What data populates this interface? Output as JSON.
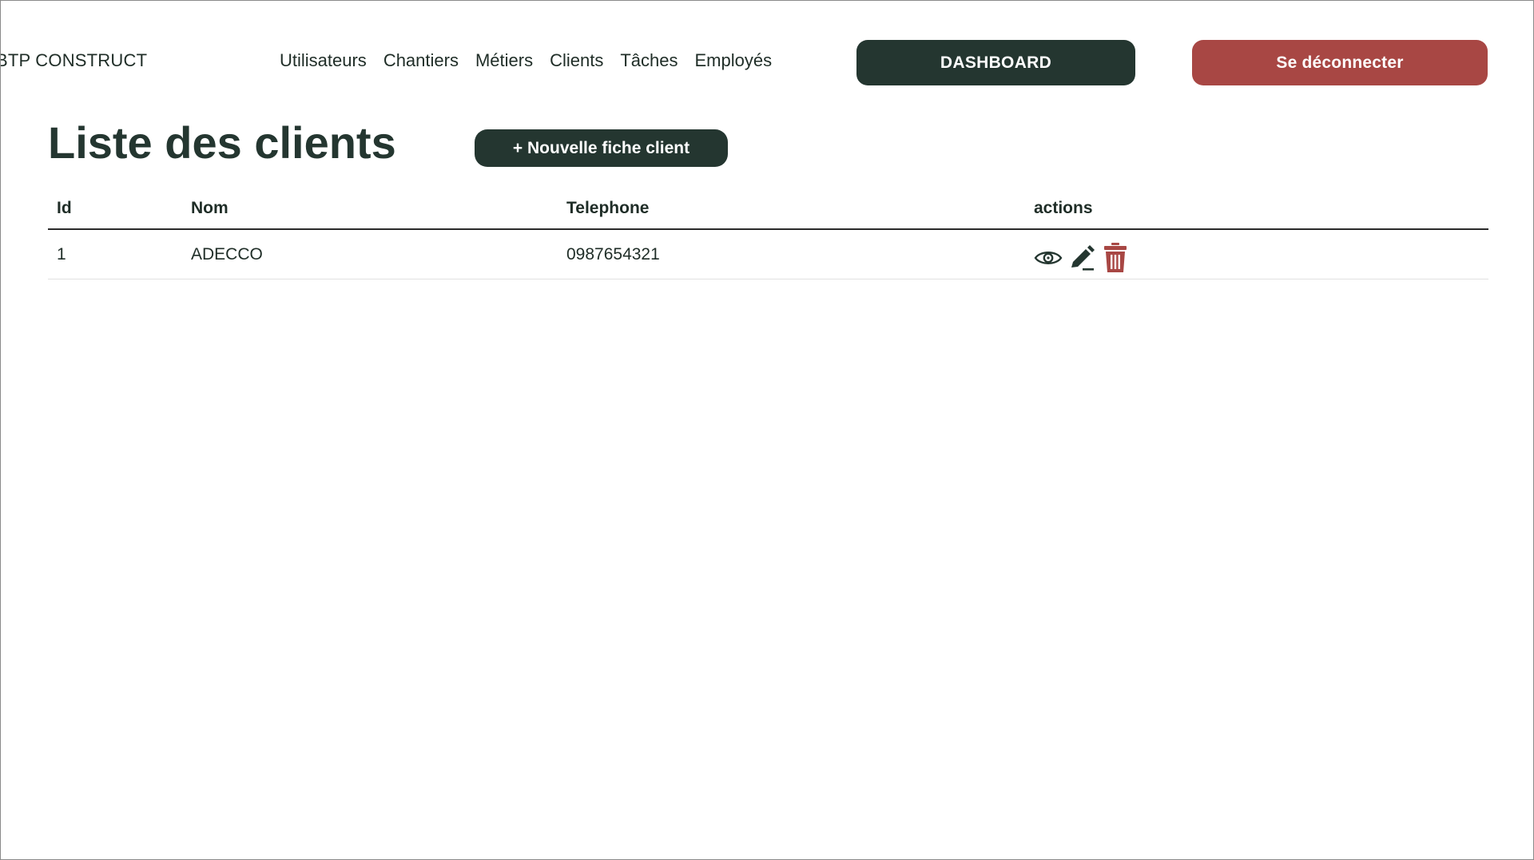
{
  "header": {
    "brand": "BTP CONSTRUCT",
    "nav": [
      {
        "label": "Utilisateurs"
      },
      {
        "label": "Chantiers"
      },
      {
        "label": "Métiers"
      },
      {
        "label": "Clients"
      },
      {
        "label": "Tâches"
      },
      {
        "label": "Employés"
      }
    ],
    "dashboard_label": "DASHBOARD",
    "logout_label": "Se déconnecter"
  },
  "main": {
    "title": "Liste des clients",
    "new_button_label": "+ Nouvelle fiche client",
    "table": {
      "columns": [
        "Id",
        "Nom",
        "Telephone",
        "actions"
      ],
      "rows": [
        {
          "id": "1",
          "nom": "ADECCO",
          "telephone": "0987654321"
        }
      ]
    }
  },
  "colors": {
    "dark": "#243630",
    "danger": "#a84744",
    "text": "#1f2d27"
  },
  "icons": {
    "view": "eye-icon",
    "edit": "pencil-icon",
    "delete": "trash-icon"
  }
}
